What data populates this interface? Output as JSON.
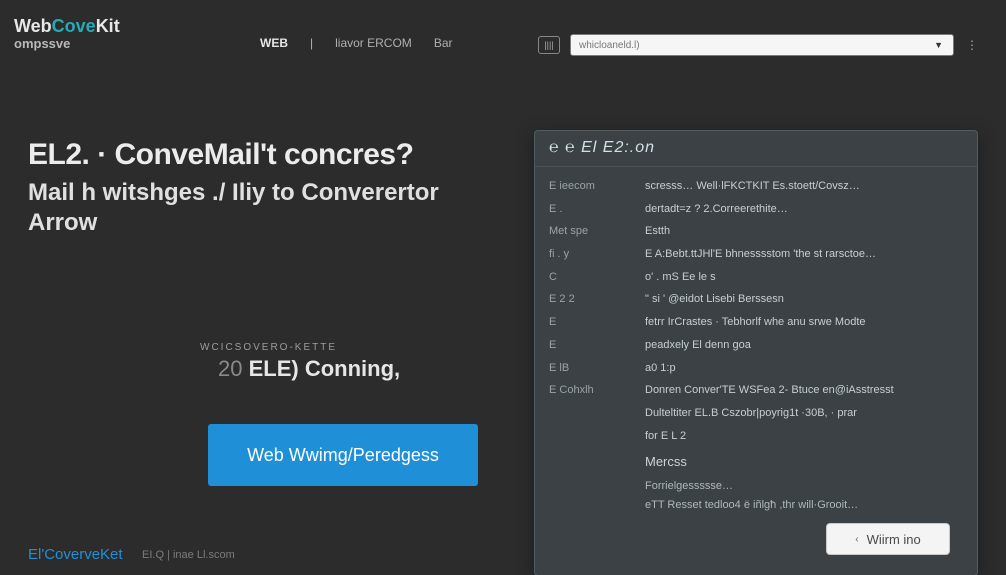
{
  "logo": {
    "part1": "Web",
    "part2": "Cove",
    "part3": "Kit",
    "line2": "ompssve"
  },
  "nav": {
    "item1": "WEB",
    "item2": " | ",
    "item3": "liavor ERCOM",
    "item4": "Bar"
  },
  "combo": {
    "iconText": "||||",
    "placeholder": "whicloaneld.l)",
    "caret": "▼",
    "kebab": "⋮"
  },
  "headline": {
    "h1": "EL2. · ConveMail't  concres?",
    "h2a": "Mail h witshges ./ Iliy to Converertor",
    "h2b": "Arrow"
  },
  "mid": {
    "caption": "WCICSOVERO-KETTE",
    "big_prefix": "20",
    "big": " ELE) Conning,"
  },
  "cta": "Web Wwimg/Peredgess",
  "footer": {
    "brand": "El'CoverveKet",
    "sub": "EI.Q | inae Ll.scom"
  },
  "inspector": {
    "title": "℮ ℮ El E2:.on",
    "rows": [
      {
        "key": "E ieecom",
        "val": "scresss…   Well·lFKCTKIT   Es.stoett/Covsz…"
      },
      {
        "key": "E .",
        "val": "dertadt=z ?         2.Correerethite…"
      },
      {
        "key": "Met   spe",
        "val": "Estth"
      },
      {
        "key": "ﬁ .   y",
        "val": "E  A:Bebt.ttJHl'E  bhnesssstom  'the st   rarsctoe…"
      },
      {
        "key": "C",
        "val": "o' . mS  Ee le s"
      },
      {
        "key": "E 2 2",
        "val": "\" si '     @eidot  Lisebi Berssesn"
      },
      {
        "key": "E",
        "val": " fetrr IrCrastes · Tebhorlf   whe  anu srwe Modte"
      },
      {
        "key": "E",
        "val": "peadxely El          denn  goa"
      },
      {
        "key": "E lB",
        "val": "                      a0 1:p"
      },
      {
        "key": "E Cohxlh",
        "val": "Donren        Conver'TE WSFea 2- Btuce en@iAsstresst"
      },
      {
        "key": "",
        "val": "Dulteltiter     EL.B Cszobr|poyrig1t  ·30B, · prar"
      },
      {
        "key": "",
        "val": "for E L 2"
      }
    ],
    "subheader": "Mercss",
    "tail": [
      "Forrielgessssse…",
      "eTT  Resset tedloo4 ё iñlgħ ,thr  will·Grooit…"
    ]
  },
  "brButton": "Wiirm ino"
}
